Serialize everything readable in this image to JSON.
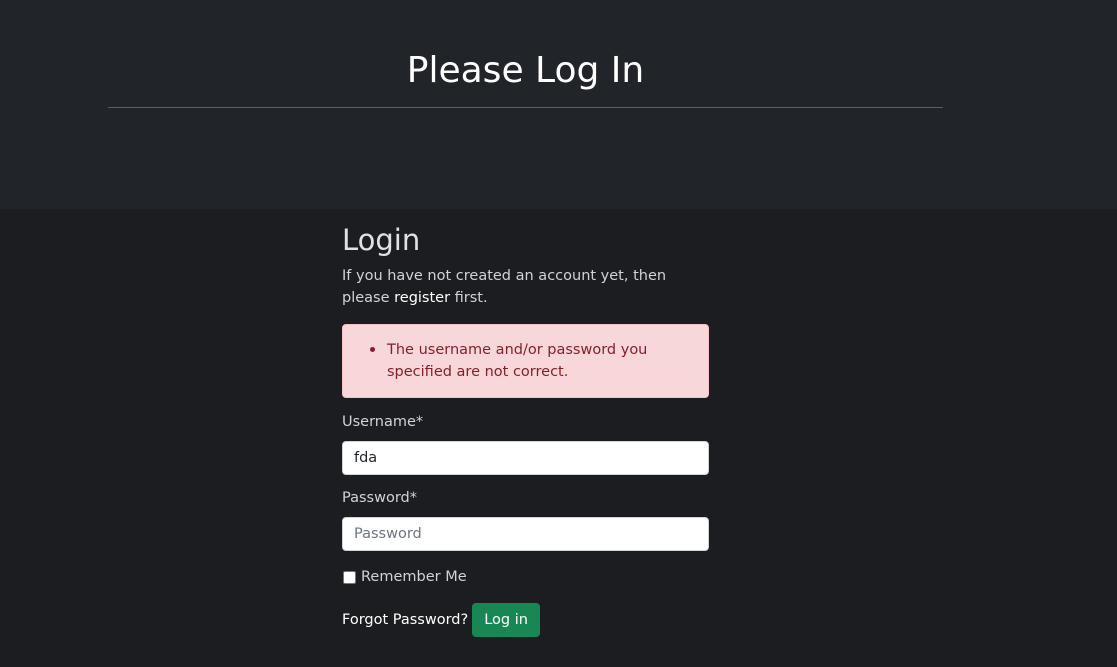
{
  "header": {
    "title": "Please Log In"
  },
  "login": {
    "heading": "Login",
    "intro_before": "If you have not created an account yet, then please",
    "register_link": "register",
    "intro_after": "first.",
    "error_message": "The username and/or password you specified are not correct.",
    "username_label": "Username*",
    "username_value": "fda",
    "password_label": "Password*",
    "password_placeholder": "Password",
    "remember_label": "Remember Me",
    "forgot_link": "Forgot Password?",
    "submit_label": "Log in"
  },
  "colors": {
    "hero_bg": "#212428",
    "page_bg": "#1b1d20",
    "alert_bg": "#f8d7da",
    "alert_text": "#842029",
    "button_bg": "#198754"
  },
  "icons": {
    "alert_bullet": "bullet-icon"
  }
}
